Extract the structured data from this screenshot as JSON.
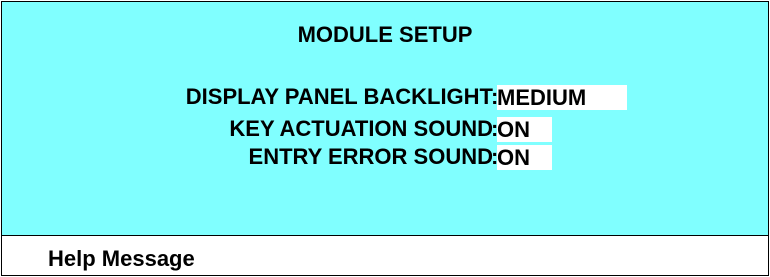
{
  "screen": {
    "title": "MODULE SETUP",
    "help_label": "Help Message"
  },
  "settings": [
    {
      "label": "DISPLAY PANEL BACKLIGHT",
      "separator": ":",
      "value": "MEDIUM"
    },
    {
      "label": "KEY ACTUATION SOUND",
      "separator": ":",
      "value": "ON"
    },
    {
      "label": "ENTRY ERROR SOUND",
      "separator": ":",
      "value": "ON"
    }
  ],
  "colors": {
    "panel_background": "#80ffff",
    "value_background": "#ffffff",
    "text": "#000000",
    "border": "#000000"
  }
}
